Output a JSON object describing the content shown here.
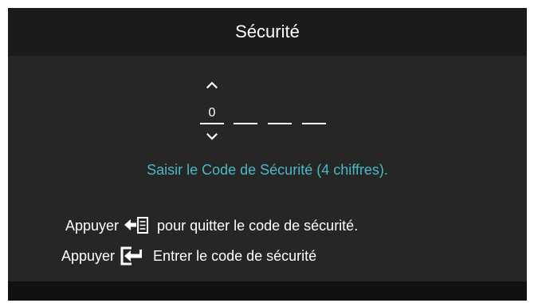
{
  "window": {
    "title": "Sécurité"
  },
  "code_entry": {
    "digits": [
      "0",
      "",
      "",
      ""
    ],
    "up_icon": "chevron-up-icon",
    "down_icon": "chevron-down-icon"
  },
  "instruction": "Saisir le Code de Sécurité (4 chiffres).",
  "help": [
    {
      "prefix": "Appuyer",
      "icon": "exit-menu-icon",
      "text": "pour quitter le code de sécurité."
    },
    {
      "prefix": "Appuyer",
      "icon": "enter-icon",
      "text": "Entrer le code de sécurité"
    }
  ],
  "colors": {
    "background": "#262626",
    "header": "#1b1b1b",
    "accent_text": "#4ab8c8",
    "text": "#ffffff"
  }
}
